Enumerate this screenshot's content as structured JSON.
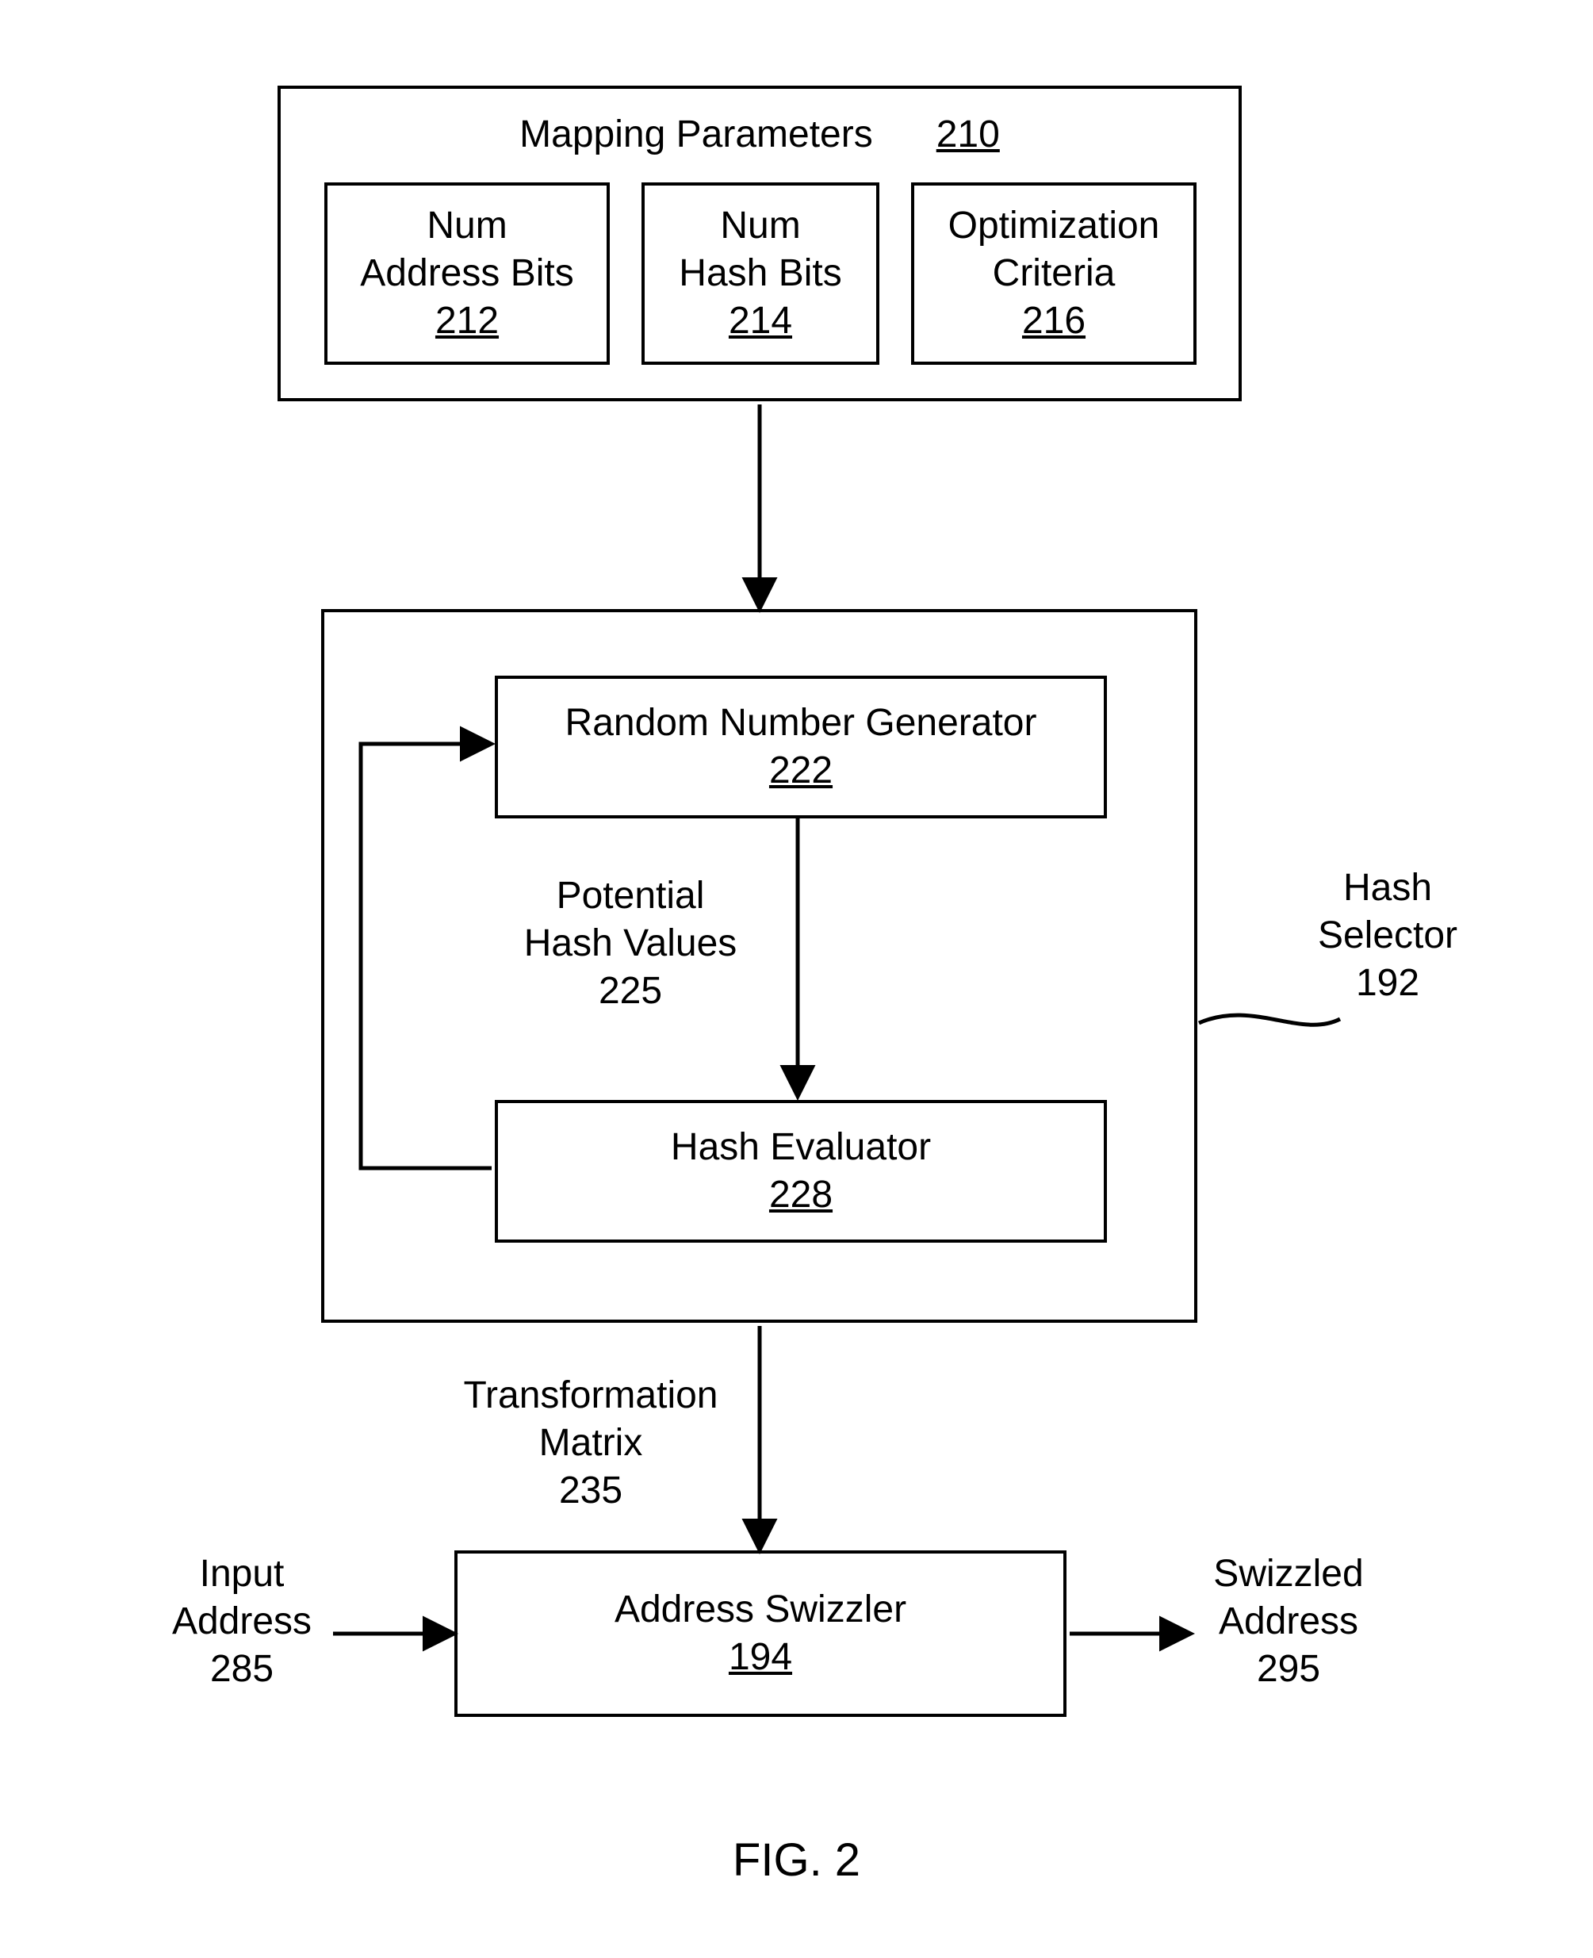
{
  "figure_label": "FIG. 2",
  "mapping_parameters": {
    "title": "Mapping Parameters",
    "ref": "210",
    "num_address_bits": {
      "line1": "Num",
      "line2": "Address Bits",
      "ref": "212"
    },
    "num_hash_bits": {
      "line1": "Num",
      "line2": "Hash Bits",
      "ref": "214"
    },
    "optimization": {
      "line1": "Optimization",
      "line2": "Criteria",
      "ref": "216"
    }
  },
  "hash_selector": {
    "side_label_line1": "Hash",
    "side_label_line2": "Selector",
    "side_ref": "192",
    "rng": {
      "title": "Random Number Generator",
      "ref": "222"
    },
    "potential": {
      "line1": "Potential",
      "line2": "Hash Values",
      "ref": "225"
    },
    "evaluator": {
      "title": "Hash Evaluator",
      "ref": "228"
    }
  },
  "transform": {
    "line1": "Transformation",
    "line2": "Matrix",
    "ref": "235"
  },
  "swizzler": {
    "title": "Address Swizzler",
    "ref": "194"
  },
  "input_addr": {
    "line1": "Input",
    "line2": "Address",
    "ref": "285"
  },
  "swz_addr": {
    "line1": "Swizzled",
    "line2": "Address",
    "ref": "295"
  }
}
